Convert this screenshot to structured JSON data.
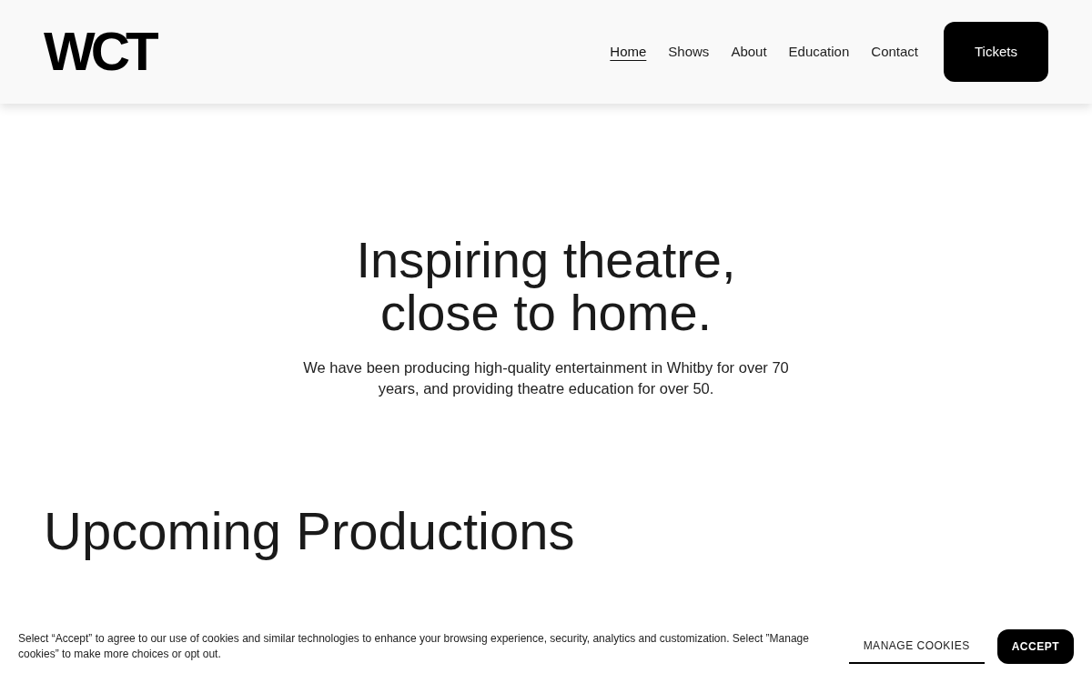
{
  "header": {
    "logo": "WCT",
    "nav": [
      {
        "label": "Home",
        "selected": true
      },
      {
        "label": "Shows",
        "selected": false
      },
      {
        "label": "About",
        "selected": false
      },
      {
        "label": "Education",
        "selected": false
      },
      {
        "label": "Contact",
        "selected": false
      }
    ],
    "cta": "Tickets"
  },
  "hero": {
    "title_lines": [
      "Inspiring theatre,",
      "close to home."
    ],
    "text": "We have been producing high-quality entertainment in Whitby for over 70 years, and providing theatre education for over 50."
  },
  "section": {
    "title": "Upcoming Productions"
  },
  "cookie_banner": {
    "text": "Select “Accept” to agree to our use of cookies and similar technologies to enhance your browsing experience, security, analytics and customization. Select ”Manage cookies” to make more choices or opt out.",
    "manage": "MANAGE COOKIES",
    "accept": "ACCEPT"
  }
}
